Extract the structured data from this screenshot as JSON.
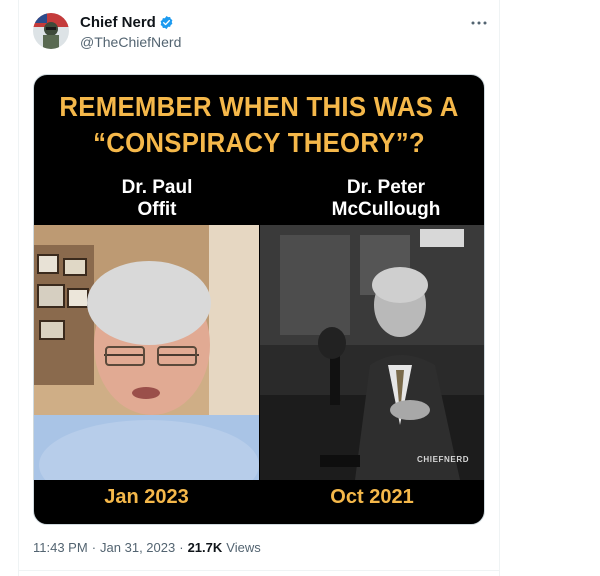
{
  "author": {
    "display_name": "Chief Nerd",
    "handle": "@TheChiefNerd",
    "verified": true,
    "avatar_icon": "avatar-image"
  },
  "menu_icon": "more-horizontal-icon",
  "media": {
    "headline_line1": "REMEMBER WHEN THIS WAS A",
    "headline_line2": "“CONSPIRACY THEORY”?",
    "left_name_line1": "Dr. Paul",
    "left_name_line2": "Offit",
    "right_name_line1": "Dr. Peter",
    "right_name_line2": "McCullough",
    "left_date": "Jan 2023",
    "right_date": "Oct 2021",
    "watermark": "CHIEFNERD"
  },
  "meta": {
    "time": "11:43 PM",
    "separator": "·",
    "date": "Jan 31, 2023",
    "views_count": "21.7K",
    "views_label": "Views"
  },
  "colors": {
    "accent_yellow": "#f5b84a",
    "verified_blue": "#1d9bf0",
    "secondary_text": "#536471"
  }
}
